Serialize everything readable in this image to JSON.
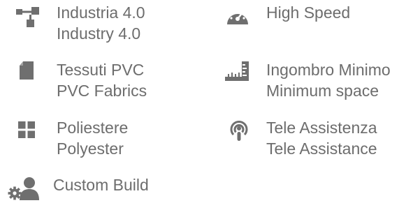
{
  "features": [
    {
      "icon": "network-icon",
      "line1": "Industria 4.0",
      "line2": "Industry 4.0"
    },
    {
      "icon": "speedometer-icon",
      "line1": "High Speed",
      "line2": ""
    },
    {
      "icon": "fabric-sheet-icon",
      "line1": "Tessuti PVC",
      "line2": "PVC Fabrics"
    },
    {
      "icon": "ruler-corner-icon",
      "line1": "Ingombro Minimo",
      "line2": "Minimum space"
    },
    {
      "icon": "grid-tiles-icon",
      "line1": "Poliestere",
      "line2": "Polyester"
    },
    {
      "icon": "podcast-antenna-icon",
      "line1": "Tele Assistenza",
      "line2": "Tele Assistance"
    },
    {
      "icon": "user-gear-icon",
      "line1": "Custom Build",
      "line2": ""
    }
  ],
  "colors": {
    "icon": "#6f6f6f",
    "text": "#6d6d6d"
  }
}
